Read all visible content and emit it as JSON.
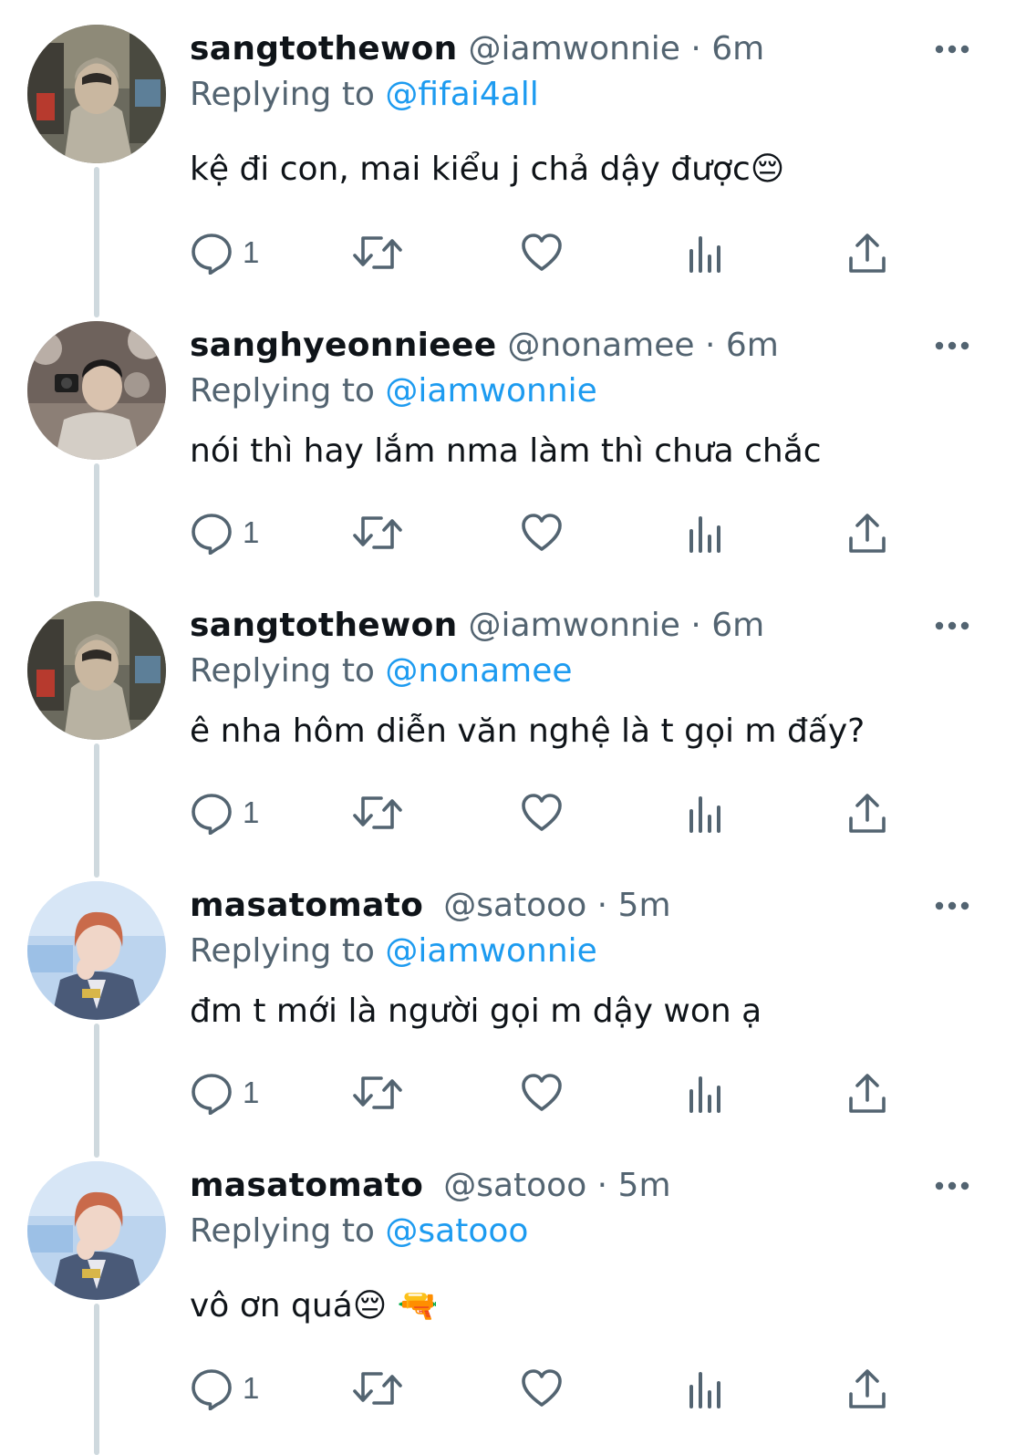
{
  "colors": {
    "text": "#0f1419",
    "secondary": "#536471",
    "accent": "#1d9bf0",
    "thread_line": "#cfd9de"
  },
  "tweets": [
    {
      "display_name": "sangtothewon",
      "handle_meta": "@iamwonnie · 6m",
      "replying_prefix": "Replying to",
      "replying_to": "@fifai4all",
      "text": "kệ đi con, mai kiểu j chả dậy được😔",
      "reply_count": "1",
      "avatar_icon": "profile-photo-hoodie"
    },
    {
      "display_name": "sanghyeonnieee",
      "handle_meta": "@nonamee · 6m",
      "replying_prefix": "Replying to",
      "replying_to": "@iamwonnie",
      "text": "nói thì hay lắm nma làm thì chưa chắc",
      "reply_count": "1",
      "avatar_icon": "profile-photo-camera"
    },
    {
      "display_name": "sangtothewon",
      "handle_meta": "@iamwonnie · 6m",
      "replying_prefix": "Replying to",
      "replying_to": "@nonamee",
      "text": "ê nha hôm diễn văn nghệ là t gọi m đấy?",
      "reply_count": "1",
      "avatar_icon": "profile-photo-hoodie"
    },
    {
      "display_name": "masatomato",
      "handle_meta": "@satooo · 5m",
      "replying_prefix": "Replying to",
      "replying_to": "@iamwonnie",
      "text": "đm t mới là người gọi m dậy won ạ",
      "reply_count": "1",
      "avatar_icon": "profile-photo-stage"
    },
    {
      "display_name": "masatomato",
      "handle_meta": "@satooo · 5m",
      "replying_prefix": "Replying to",
      "replying_to": "@satooo",
      "text": "vô ơn quá😔 🔫",
      "reply_count": "1",
      "avatar_icon": "profile-photo-stage"
    }
  ]
}
